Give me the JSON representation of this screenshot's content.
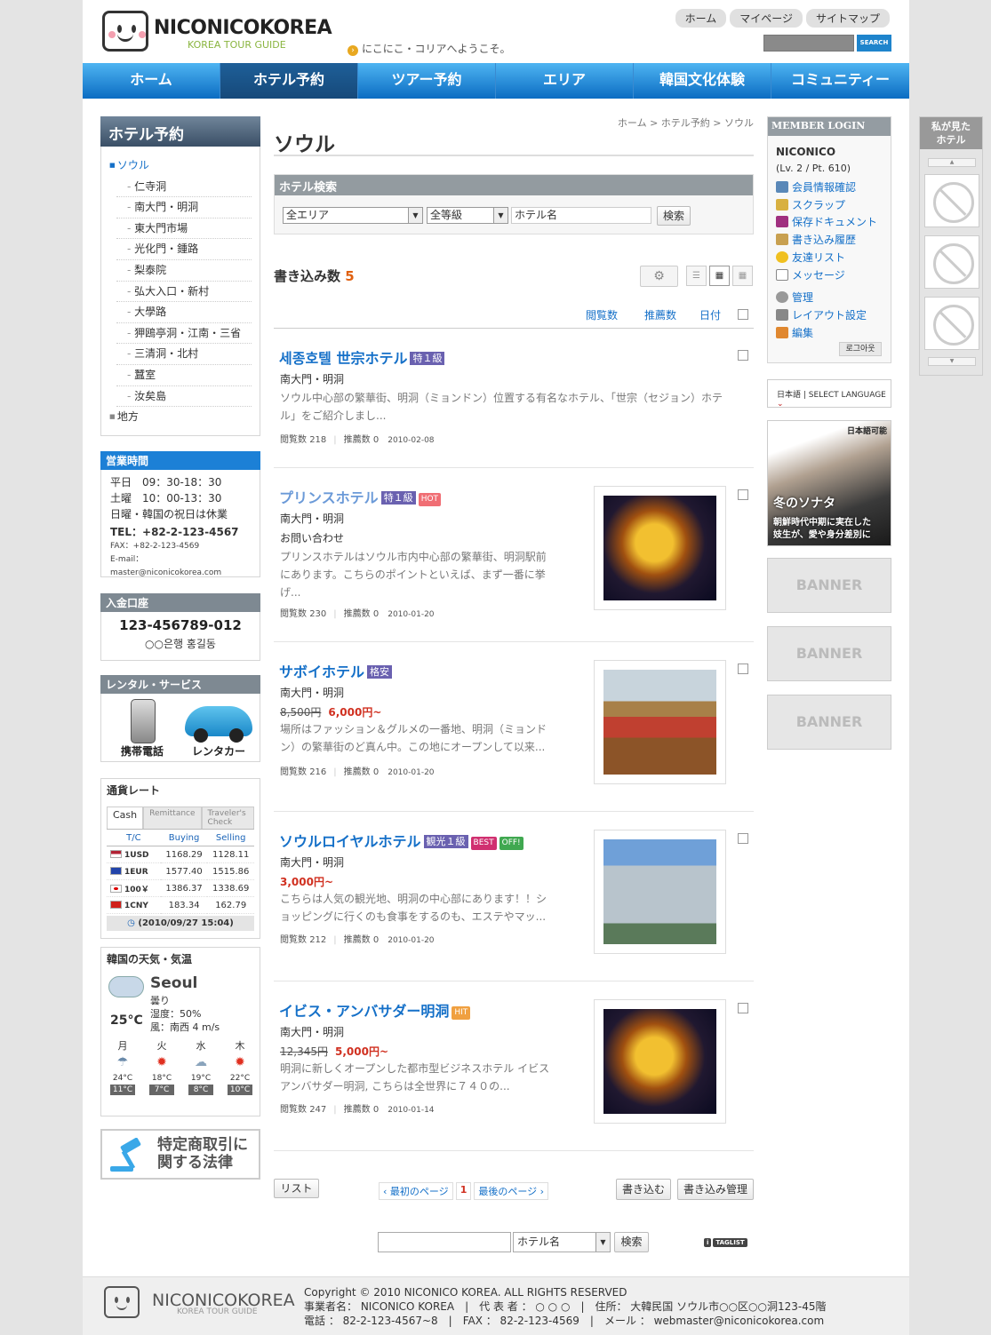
{
  "header": {
    "logo_name": "NICONICOKOREA",
    "logo_sub": "KOREA TOUR GUIDE",
    "welcome": "にこにこ・コリアへようこそ。",
    "top_links": [
      "ホーム",
      "マイページ",
      "サイトマップ"
    ],
    "search_button": "SEARCH"
  },
  "gnb": [
    "ホーム",
    "ホテル予約",
    "ツアー予約",
    "エリア",
    "韓国文化体験",
    "コミュニティー"
  ],
  "sidebar": {
    "title": "ホテル予約",
    "main": "ソウル",
    "items": [
      "仁寺洞",
      "南大門・明洞",
      "東大門市場",
      "光化門・鍾路",
      "梨泰院",
      "弘大入口・新村",
      "大學路",
      "狎鴎亭洞・江南・三省",
      "三清洞・北村",
      "蠶室",
      "汝矣島"
    ],
    "region": "地方"
  },
  "hours": {
    "title": "営業時間",
    "weekday": "平日　09：30-18：30",
    "saturday": "土曜　10：00-13：30",
    "holiday": "日曜・韓国の祝日は休業",
    "tel": "TEL：+82-2-123-4567",
    "fax": "FAX：+82-2-123-4569",
    "email": "E-mail：master@niconicokorea.com"
  },
  "bank": {
    "title": "入金口座",
    "number": "123-456789-012",
    "name": "○○은행 홍길동"
  },
  "rental": {
    "title": "レンタル・サービス",
    "phone_label": "携帯電話",
    "car_label": "レンタカー"
  },
  "exchange": {
    "title": "通貨レート",
    "tabs": [
      "Cash",
      "Remittance",
      "Traveler's Check"
    ],
    "headers": [
      "T/C",
      "Buying",
      "Selling"
    ],
    "rows": [
      {
        "currency": "1USD",
        "buying": "1168.29",
        "selling": "1128.11"
      },
      {
        "currency": "1EUR",
        "buying": "1577.40",
        "selling": "1515.86"
      },
      {
        "currency": "100￥",
        "buying": "1386.37",
        "selling": "1338.69"
      },
      {
        "currency": "1CNY",
        "buying": "183.34",
        "selling": "162.79"
      }
    ],
    "date": "(2010/09/27 15:04)"
  },
  "weather": {
    "title": "韓国の天気・気温",
    "city": "Seoul",
    "condition": "曇り",
    "humidity": "湿度：50%",
    "wind": "風：南西 4 m/s",
    "temp": "25°C",
    "forecast": [
      {
        "day": "月",
        "high": "24°C",
        "low": "11°C"
      },
      {
        "day": "火",
        "high": "18°C",
        "low": "7°C"
      },
      {
        "day": "水",
        "high": "19°C",
        "low": "8°C"
      },
      {
        "day": "木",
        "high": "22°C",
        "low": "10°C"
      }
    ]
  },
  "law_banner": {
    "line1": "特定商取引に",
    "line2": "関する法律"
  },
  "board": {
    "breadcrumb": "ホーム > ホテル予約 > ソウル",
    "title": "ソウル",
    "search_title": "ホテル検索",
    "area_select": "全エリア",
    "grade_select": "全等級",
    "keyword_value": "ホテル名",
    "search_button": "検索",
    "count_label": "書き込み数",
    "count": "5",
    "sort": [
      "閲覧数",
      "推薦数",
      "日付"
    ],
    "posts": [
      {
        "title": "세종호텔 世宗ホテル",
        "tags": [
          "特１級"
        ],
        "area": "南大門・明洞",
        "extra": "",
        "price_old": "",
        "price_new": "",
        "desc1": "ソウル中心部の繁華街、明洞（ミョンドン）位置する有名なホテル、「世宗（セジョン）ホテ",
        "desc2": "ル」をご紹介しまし...",
        "views_label": "閲覧数",
        "views": "218",
        "recs_label": "推薦数",
        "recs": "0",
        "date": "2010-02-08"
      },
      {
        "title": "プリンスホテル",
        "tags": [
          "特１級",
          "HOT"
        ],
        "area": "南大門・明洞",
        "extra": "お問い合わせ",
        "price_old": "",
        "price_new": "",
        "desc1": "プリンスホテルはソウル市内中心部の繁華街、明洞駅前",
        "desc2": "にあります。こちらのポイントといえば、まず一番に挙",
        "desc3": "げ...",
        "views_label": "閲覧数",
        "views": "230",
        "recs_label": "推薦数",
        "recs": "0",
        "date": "2010-01-20"
      },
      {
        "title": "サボイホテル",
        "tags": [
          "格安"
        ],
        "area": "南大門・明洞",
        "extra": "",
        "price_old": "8,500円",
        "price_new": "6,000円~",
        "desc1": "場所はファッション＆グルメの一番地、明洞（ミョンド",
        "desc2": "ン）の繁華街のど真ん中。この地にオープンして以来...",
        "views_label": "閲覧数",
        "views": "216",
        "recs_label": "推薦数",
        "recs": "0",
        "date": "2010-01-20"
      },
      {
        "title": "ソウルロイヤルホテル",
        "tags": [
          "観光１級",
          "BEST",
          "OFF!"
        ],
        "area": "南大門・明洞",
        "extra": "",
        "price_old": "",
        "price_new": "3,000円~",
        "desc1": "こちらは人気の観光地、明洞の中心部にあります！！シ",
        "desc2": "ョッピングに行くのも食事をするのも、エステやマッ...",
        "views_label": "閲覧数",
        "views": "212",
        "recs_label": "推薦数",
        "recs": "0",
        "date": "2010-01-20"
      },
      {
        "title": "イビス・アンバサダー明洞",
        "tags": [
          "HIT"
        ],
        "area": "南大門・明洞",
        "extra": "",
        "price_old": "12,345円",
        "price_new": "5,000円~",
        "desc1": "明洞に新しくオープンした都市型ビジネスホテル イビス",
        "desc2": "アンバサダー明洞, こちらは全世界に７４０の...",
        "views_label": "閲覧数",
        "views": "247",
        "recs_label": "推薦数",
        "recs": "0",
        "date": "2010-01-14"
      }
    ],
    "list_button": "リスト",
    "pager_first": "‹ 最初のページ",
    "pager_current": "1",
    "pager_last": "最後のページ ›",
    "write_button": "書き込む",
    "manage_button": "書き込み管理",
    "bottom_select": "ホテル名",
    "bottom_search_button": "検索",
    "taglist": "TAGLIST"
  },
  "login": {
    "title": "MEMBER LOGIN",
    "user": "NICONICO",
    "level": "(Lv. 2 / Pt. 610)",
    "menu": [
      "会員情報確認",
      "スクラップ",
      "保存ドキュメント",
      "書き込み履歴",
      "友達リスト",
      "メッセージ",
      "管理",
      "レイアウト設定",
      "編集"
    ],
    "logout": "로그아웃"
  },
  "lang": {
    "current": "日本語",
    "select": "SELECT LANGUAGE"
  },
  "drama": {
    "tag": "日本語可能",
    "title": "冬のソナタ",
    "caption1": "朝鮮時代中期に実在した",
    "caption2": "妓生が、愛や身分差別に"
  },
  "banners": [
    "BANNER",
    "BANNER",
    "BANNER"
  ],
  "floating": {
    "title1": "私が見た",
    "title2": "ホテル"
  },
  "footer": {
    "logo_name": "NICONICOKOREA",
    "logo_sub": "KOREA TOUR GUIDE",
    "line1": "Copyright © 2010 NICONICO KOREA. ALL RIGHTS RESERVED",
    "line2": "事業者名： NICONICO KOREA　|　代 表 者 ： ○ ○ ○　|　住所： 大韓民国 ソウル市○○区○○洞123-45階",
    "line3": "電話 ： 82-2-123-4567~8　|　FAX ： 82-2-123-4569　|　メール ： webmaster@niconicokorea.com"
  },
  "colors": {
    "accent": "#1570c8",
    "nav": "#1c80d6",
    "price": "#d03020"
  }
}
